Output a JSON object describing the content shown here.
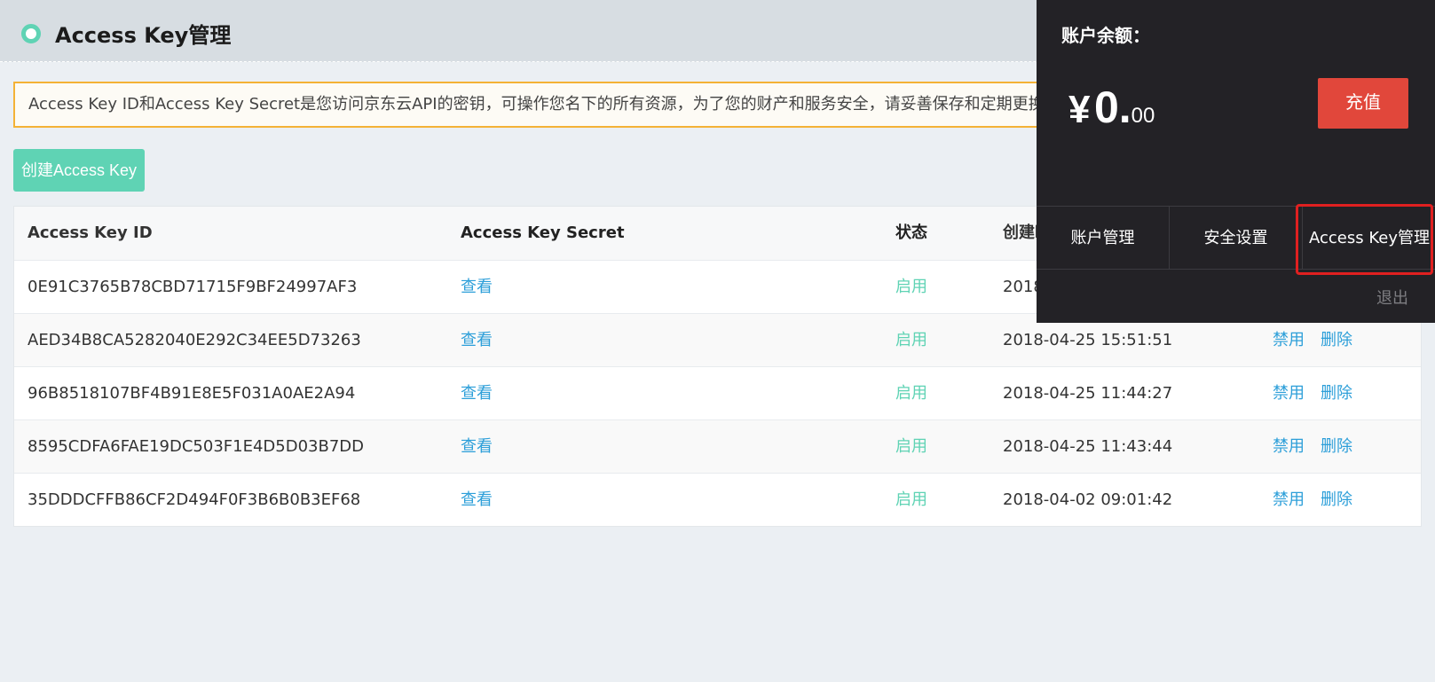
{
  "header": {
    "title": "Access Key管理"
  },
  "notice": {
    "text": "Access Key ID和Access Key Secret是您访问京东云API的密钥，可操作您名下的所有资源，为了您的财产和服务安全，请妥善保存和定期更换密"
  },
  "toolbar": {
    "create_label": "创建Access Key"
  },
  "table": {
    "headers": [
      "Access Key ID",
      "Access Key Secret",
      "状态",
      "创建时间"
    ],
    "rows": [
      {
        "id": "0E91C3765B78CBD71715F9BF24997AF3",
        "secret": "查看",
        "status": "启用",
        "created": "2018",
        "disable": "",
        "delete": ""
      },
      {
        "id": "AED34B8CA5282040E292C34EE5D73263",
        "secret": "查看",
        "status": "启用",
        "created": "2018-04-25 15:51:51",
        "disable": "禁用",
        "delete": "删除"
      },
      {
        "id": "96B8518107BF4B91E8E5F031A0AE2A94",
        "secret": "查看",
        "status": "启用",
        "created": "2018-04-25 11:44:27",
        "disable": "禁用",
        "delete": "删除"
      },
      {
        "id": "8595CDFA6FAE19DC503F1E4D5D03B7DD",
        "secret": "查看",
        "status": "启用",
        "created": "2018-04-25 11:43:44",
        "disable": "禁用",
        "delete": "删除"
      },
      {
        "id": "35DDDCFFB86CF2D494F0F3B6B0B3EF68",
        "secret": "查看",
        "status": "启用",
        "created": "2018-04-02 09:01:42",
        "disable": "禁用",
        "delete": "删除"
      }
    ]
  },
  "account_popup": {
    "balance_label": "账户余额：",
    "currency": "¥",
    "balance_int": "0.",
    "balance_dec": "00",
    "recharge_label": "充值",
    "menu": [
      "账户管理",
      "安全设置",
      "Access Key管理"
    ],
    "logout_label": "退出"
  },
  "colors": {
    "accent": "#5fd3b4",
    "link": "#2d9fd9",
    "recharge": "#e1473b",
    "highlight": "#e02020",
    "popup_bg": "#232226"
  }
}
